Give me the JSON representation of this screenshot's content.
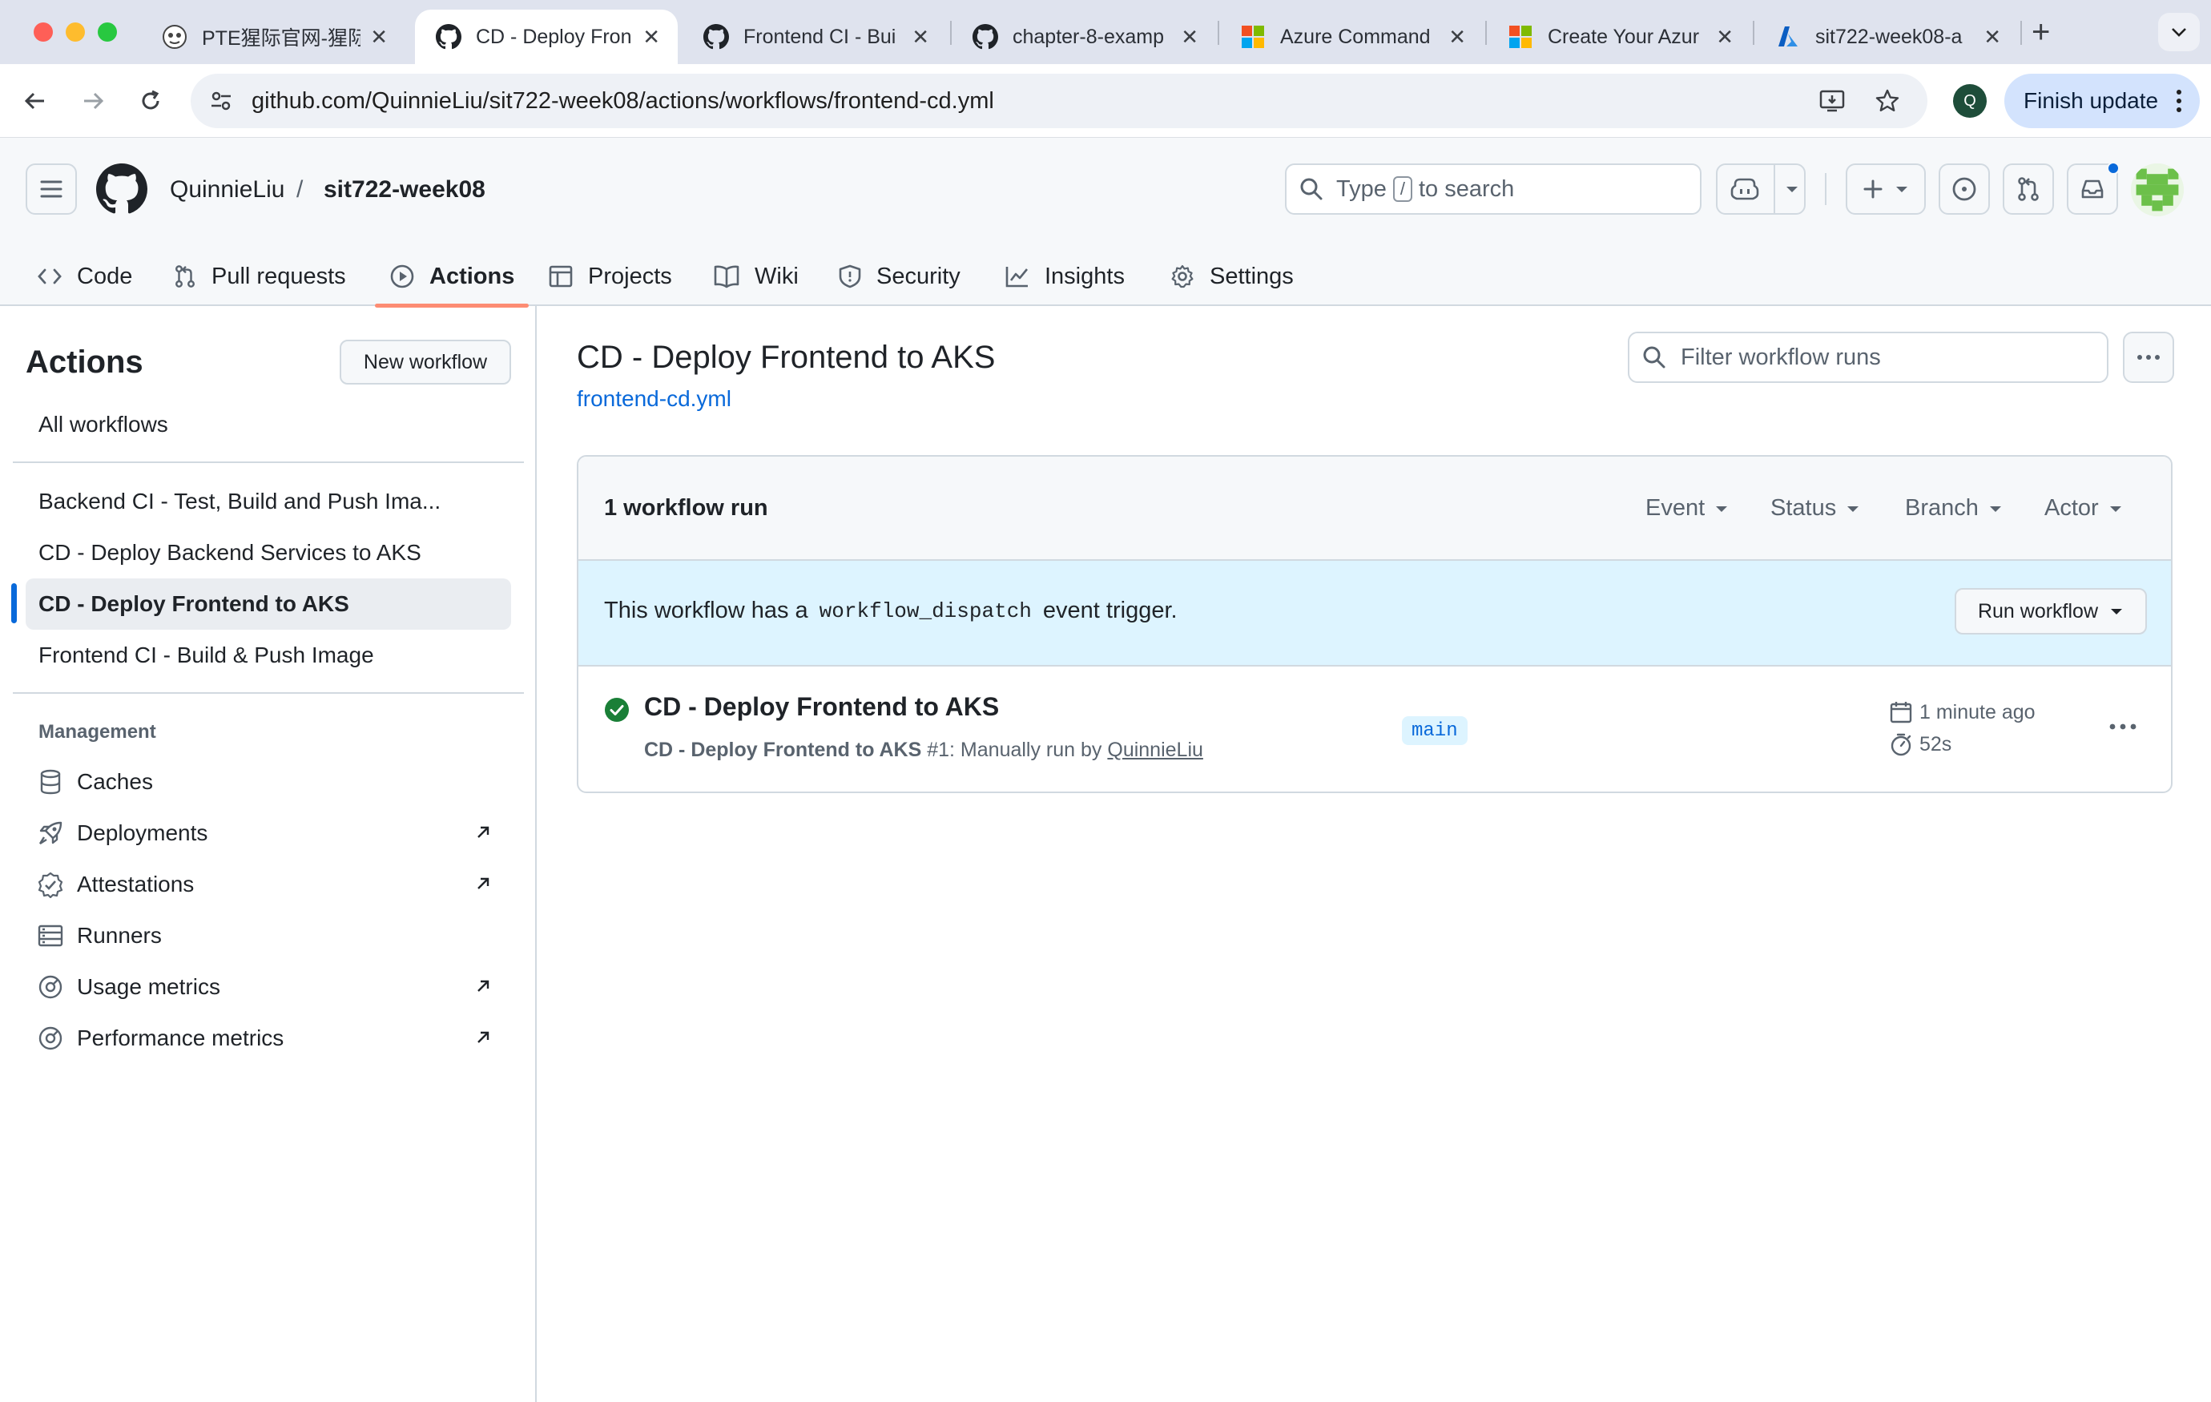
{
  "browser": {
    "tabs": [
      {
        "title": "PTE猩际官网-猩际",
        "icon": "pte-favicon-icon",
        "active": false
      },
      {
        "title": "CD - Deploy Fron",
        "icon": "github-icon",
        "active": true
      },
      {
        "title": "Frontend CI - Bui",
        "icon": "github-icon",
        "active": false
      },
      {
        "title": "chapter-8-examp",
        "icon": "github-icon",
        "active": false
      },
      {
        "title": "Azure Command",
        "icon": "microsoft-icon",
        "active": false
      },
      {
        "title": "Create Your Azur",
        "icon": "microsoft-icon",
        "active": false
      },
      {
        "title": "sit722-week08-a",
        "icon": "azure-icon",
        "active": false
      }
    ],
    "url": "github.com/QuinnieLiu/sit722-week08/actions/workflows/frontend-cd.yml",
    "profile_initial": "Q",
    "finish_update_label": "Finish update"
  },
  "github": {
    "owner": "QuinnieLiu",
    "separator": "/",
    "repo": "sit722-week08",
    "search": {
      "prefix": "Type",
      "key": "/",
      "suffix": "to search"
    },
    "nav": [
      {
        "label": "Code",
        "icon": "code-icon"
      },
      {
        "label": "Pull requests",
        "icon": "pull-request-icon"
      },
      {
        "label": "Actions",
        "icon": "play-icon",
        "selected": true
      },
      {
        "label": "Projects",
        "icon": "table-icon"
      },
      {
        "label": "Wiki",
        "icon": "book-icon"
      },
      {
        "label": "Security",
        "icon": "shield-icon"
      },
      {
        "label": "Insights",
        "icon": "graph-icon"
      },
      {
        "label": "Settings",
        "icon": "gear-icon"
      }
    ]
  },
  "sidebar": {
    "title": "Actions",
    "new_workflow_label": "New workflow",
    "all_workflows_label": "All workflows",
    "workflows": [
      {
        "label": "Backend CI - Test, Build and Push Ima...",
        "selected": false
      },
      {
        "label": "CD - Deploy Backend Services to AKS",
        "selected": false
      },
      {
        "label": "CD - Deploy Frontend to AKS",
        "selected": true
      },
      {
        "label": "Frontend CI - Build & Push Image",
        "selected": false
      }
    ],
    "management_heading": "Management",
    "management": [
      {
        "label": "Caches",
        "icon": "database-icon",
        "external": false
      },
      {
        "label": "Deployments",
        "icon": "rocket-icon",
        "external": true
      },
      {
        "label": "Attestations",
        "icon": "verified-icon",
        "external": true
      },
      {
        "label": "Runners",
        "icon": "server-icon",
        "external": false
      },
      {
        "label": "Usage metrics",
        "icon": "meter-icon",
        "external": true
      },
      {
        "label": "Performance metrics",
        "icon": "meter-icon",
        "external": true
      }
    ]
  },
  "main": {
    "title": "CD - Deploy Frontend to AKS",
    "file": "frontend-cd.yml",
    "filter_placeholder": "Filter workflow runs",
    "run_count": "1 workflow run",
    "filters": [
      "Event",
      "Status",
      "Branch",
      "Actor"
    ],
    "dispatch": {
      "prefix": "This workflow has a",
      "code": "workflow_dispatch",
      "suffix": "event trigger.",
      "button": "Run workflow"
    },
    "run": {
      "title": "CD - Deploy Frontend to AKS",
      "desc_bold": "CD - Deploy Frontend to AKS",
      "desc_mid": "#1: Manually run by",
      "actor": "QuinnieLiu",
      "branch": "main",
      "time": "1 minute ago",
      "duration": "52s",
      "status": "success"
    }
  },
  "colors": {
    "accent": "#0969da",
    "selected_tab_underline": "#fd8c73",
    "success": "#1a7f37",
    "info_banner": "#ddf4ff"
  }
}
